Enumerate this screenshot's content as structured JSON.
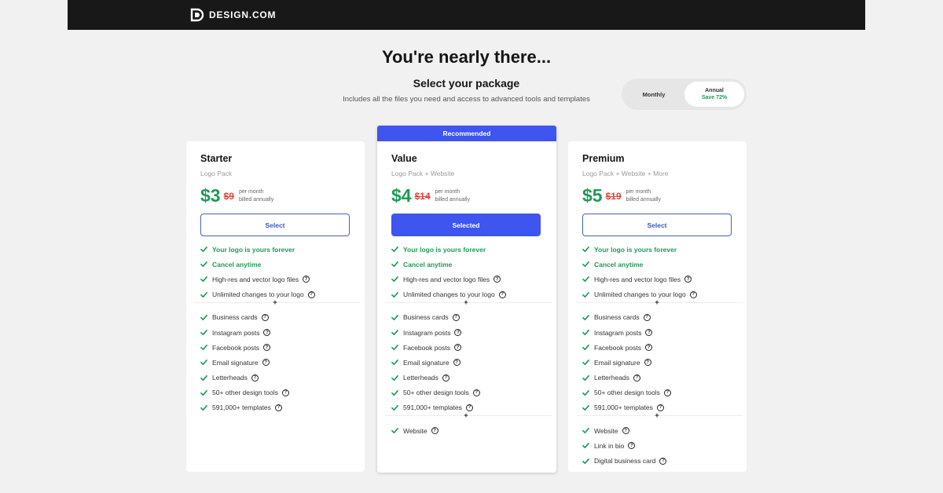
{
  "brand": {
    "name": "DESIGN.COM"
  },
  "heading": {
    "title": "You're nearly there...",
    "subtitle": "Select your package",
    "description": "Includes all the files you need and access to advanced tools and templates"
  },
  "billing_toggle": {
    "monthly_label": "Monthly",
    "annual_label": "Annual",
    "annual_save": "Save 72%",
    "selected": "Annual"
  },
  "colors": {
    "accent": "#3e55ef",
    "green": "#1f9a56",
    "red": "#e0453c",
    "topbar": "#181818"
  },
  "plans": [
    {
      "name": "Starter",
      "sub": "Logo Pack",
      "price": "$3",
      "old_price": "$9",
      "billing_1": "per month",
      "billing_2": "billed annually",
      "button": "Select",
      "features_core": [
        "Your logo is yours forever",
        "Cancel anytime",
        "High-res and vector logo files",
        "Unlimited changes to your logo"
      ],
      "plus": "+",
      "features_tools": [
        "Business cards",
        "Instagram posts",
        "Facebook posts",
        "Email signature",
        "Letterheads",
        "50+ other design tools",
        "591,000+ templates"
      ]
    },
    {
      "name": "Value",
      "sub": "Logo Pack + Website",
      "price": "$4",
      "old_price": "$14",
      "billing_1": "per month",
      "billing_2": "billed annually",
      "button": "Selected",
      "badge": "Recommended",
      "features_core": [
        "Your logo is yours forever",
        "Cancel anytime",
        "High-res and vector logo files",
        "Unlimited changes to your logo"
      ],
      "plus": "+",
      "features_tools": [
        "Business cards",
        "Instagram posts",
        "Facebook posts",
        "Email signature",
        "Letterheads",
        "50+ other design tools",
        "591,000+ templates"
      ],
      "features_extra": [
        "Website"
      ]
    },
    {
      "name": "Premium",
      "sub": "Logo Pack + Website + More",
      "price": "$5",
      "old_price": "$19",
      "billing_1": "per month",
      "billing_2": "billed annually",
      "button": "Select",
      "features_core": [
        "Your logo is yours forever",
        "Cancel anytime",
        "High-res and vector logo files",
        "Unlimited changes to your logo"
      ],
      "plus": "+",
      "features_tools": [
        "Business cards",
        "Instagram posts",
        "Facebook posts",
        "Email signature",
        "Letterheads",
        "50+ other design tools",
        "591,000+ templates"
      ],
      "features_extra": [
        "Website",
        "Link in bio",
        "Digital business card"
      ]
    }
  ],
  "help_glyph": "?"
}
